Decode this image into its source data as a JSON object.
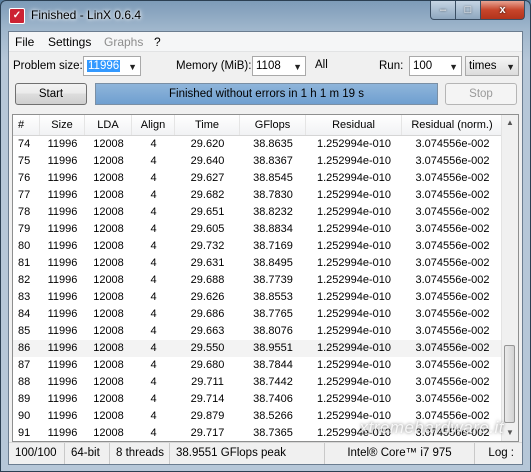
{
  "window": {
    "title": "Finished - LinX 0.6.4",
    "controls": {
      "minimize": "–",
      "maximize": "□",
      "close": "x"
    }
  },
  "menu": [
    {
      "label": "File",
      "enabled": true
    },
    {
      "label": "Settings",
      "enabled": true
    },
    {
      "label": "Graphs",
      "enabled": false
    },
    {
      "label": "?",
      "enabled": true
    }
  ],
  "settings": {
    "problem_size_label": "Problem size:",
    "problem_size_value": "11996",
    "memory_label": "Memory (MiB):",
    "memory_value": "1108",
    "memory_all": "All",
    "run_label": "Run:",
    "run_value": "100",
    "run_unit": "times"
  },
  "actions": {
    "start_label": "Start",
    "status_text": "Finished without errors in 1 h 1 m 19 s",
    "stop_label": "Stop"
  },
  "table": {
    "columns": [
      "#",
      "Size",
      "LDA",
      "Align",
      "Time",
      "GFlops",
      "Residual",
      "Residual (norm.)"
    ],
    "highlighted_row": 12,
    "rows": [
      [
        "74",
        "11996",
        "12008",
        "4",
        "29.620",
        "38.8635",
        "1.252994e-010",
        "3.074556e-002"
      ],
      [
        "75",
        "11996",
        "12008",
        "4",
        "29.640",
        "38.8367",
        "1.252994e-010",
        "3.074556e-002"
      ],
      [
        "76",
        "11996",
        "12008",
        "4",
        "29.627",
        "38.8545",
        "1.252994e-010",
        "3.074556e-002"
      ],
      [
        "77",
        "11996",
        "12008",
        "4",
        "29.682",
        "38.7830",
        "1.252994e-010",
        "3.074556e-002"
      ],
      [
        "78",
        "11996",
        "12008",
        "4",
        "29.651",
        "38.8232",
        "1.252994e-010",
        "3.074556e-002"
      ],
      [
        "79",
        "11996",
        "12008",
        "4",
        "29.605",
        "38.8834",
        "1.252994e-010",
        "3.074556e-002"
      ],
      [
        "80",
        "11996",
        "12008",
        "4",
        "29.732",
        "38.7169",
        "1.252994e-010",
        "3.074556e-002"
      ],
      [
        "81",
        "11996",
        "12008",
        "4",
        "29.631",
        "38.8495",
        "1.252994e-010",
        "3.074556e-002"
      ],
      [
        "82",
        "11996",
        "12008",
        "4",
        "29.688",
        "38.7739",
        "1.252994e-010",
        "3.074556e-002"
      ],
      [
        "83",
        "11996",
        "12008",
        "4",
        "29.626",
        "38.8553",
        "1.252994e-010",
        "3.074556e-002"
      ],
      [
        "84",
        "11996",
        "12008",
        "4",
        "29.686",
        "38.7765",
        "1.252994e-010",
        "3.074556e-002"
      ],
      [
        "85",
        "11996",
        "12008",
        "4",
        "29.663",
        "38.8076",
        "1.252994e-010",
        "3.074556e-002"
      ],
      [
        "86",
        "11996",
        "12008",
        "4",
        "29.550",
        "38.9551",
        "1.252994e-010",
        "3.074556e-002"
      ],
      [
        "87",
        "11996",
        "12008",
        "4",
        "29.680",
        "38.7844",
        "1.252994e-010",
        "3.074556e-002"
      ],
      [
        "88",
        "11996",
        "12008",
        "4",
        "29.711",
        "38.7442",
        "1.252994e-010",
        "3.074556e-002"
      ],
      [
        "89",
        "11996",
        "12008",
        "4",
        "29.714",
        "38.7406",
        "1.252994e-010",
        "3.074556e-002"
      ],
      [
        "90",
        "11996",
        "12008",
        "4",
        "29.879",
        "38.5266",
        "1.252994e-010",
        "3.074556e-002"
      ],
      [
        "91",
        "11996",
        "12008",
        "4",
        "29.717",
        "38.7365",
        "1.252994e-010",
        "3.074556e-002"
      ]
    ]
  },
  "statusbar": {
    "progress": "100/100",
    "arch": "64-bit",
    "threads": "8 threads",
    "peak": "38.9551 GFlops peak",
    "cpu": "Intel® Core™ i7 975",
    "log": "Log :"
  },
  "watermark": "xtremehardware.it",
  "colors": {
    "status_fill": "#7fa9d6",
    "close_button": "#c7452b"
  }
}
